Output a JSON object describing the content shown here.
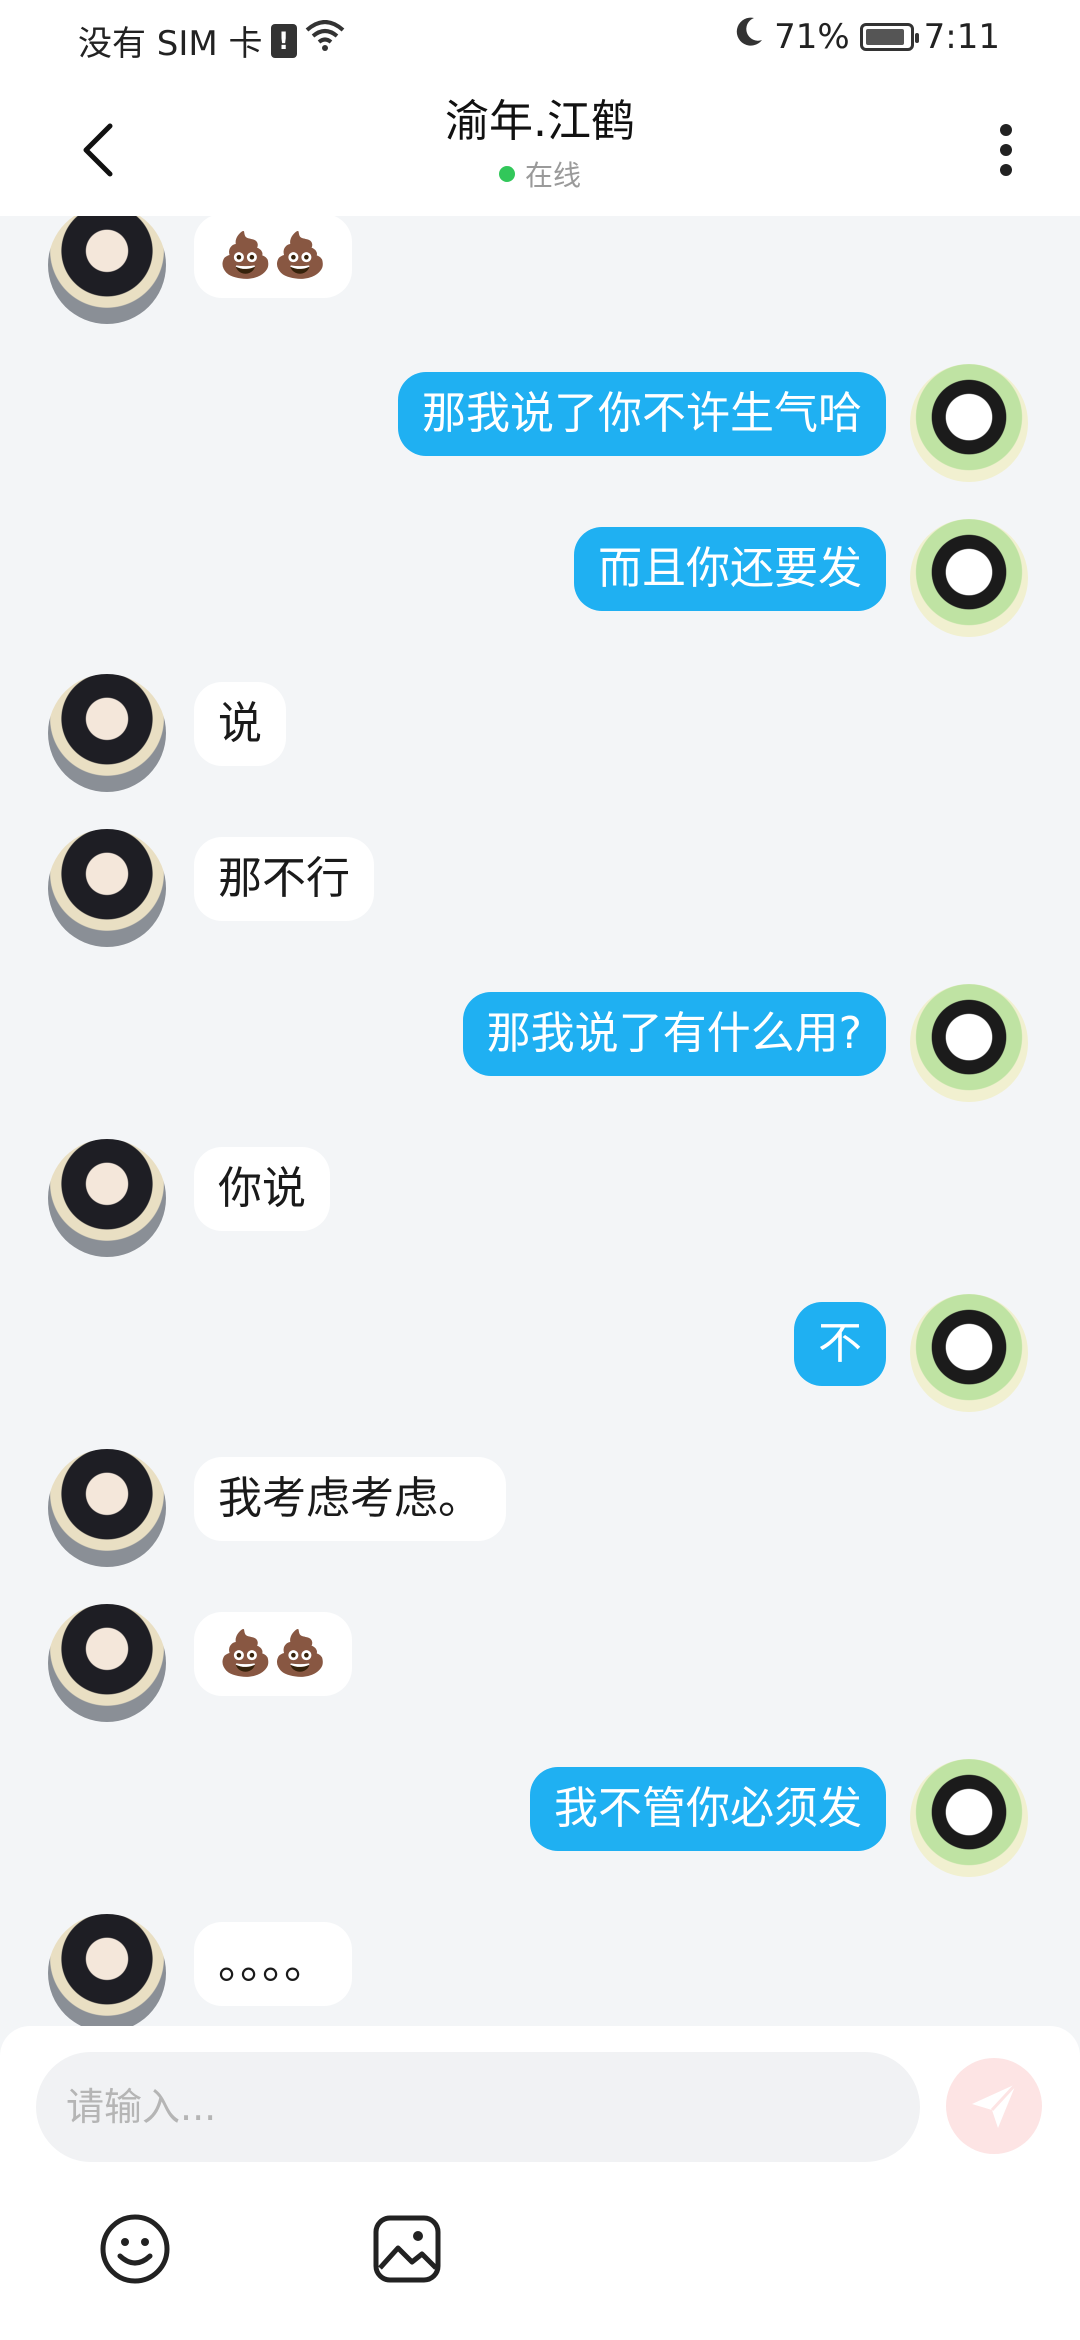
{
  "status_bar": {
    "carrier": "没有 SIM 卡",
    "sim_alert": "!",
    "battery": "71%",
    "time": "7:11"
  },
  "header": {
    "contact_name": "渝年.江鹤",
    "status": "在线"
  },
  "messages": [
    {
      "from": "other",
      "text": "💩💩"
    },
    {
      "from": "self",
      "text": "那我说了你不许生气哈"
    },
    {
      "from": "self",
      "text": "而且你还要发"
    },
    {
      "from": "other",
      "text": "说"
    },
    {
      "from": "other",
      "text": "那不行"
    },
    {
      "from": "self",
      "text": "那我说了有什么用?"
    },
    {
      "from": "other",
      "text": "你说"
    },
    {
      "from": "self",
      "text": "不"
    },
    {
      "from": "other",
      "text": "我考虑考虑。"
    },
    {
      "from": "other",
      "text": "💩💩"
    },
    {
      "from": "self",
      "text": "我不管你必须发"
    },
    {
      "from": "other",
      "text": "。。。。"
    }
  ],
  "composer": {
    "placeholder": "请输入..."
  },
  "icons": {
    "back": "chevron-left-icon",
    "more": "more-vertical-icon",
    "send": "send-icon",
    "emoji": "emoji-icon",
    "image": "image-icon"
  },
  "colors": {
    "self_bubble": "#1fb0f2",
    "other_bubble": "#ffffff",
    "online": "#32c75a",
    "background": "#f3f5f7"
  }
}
